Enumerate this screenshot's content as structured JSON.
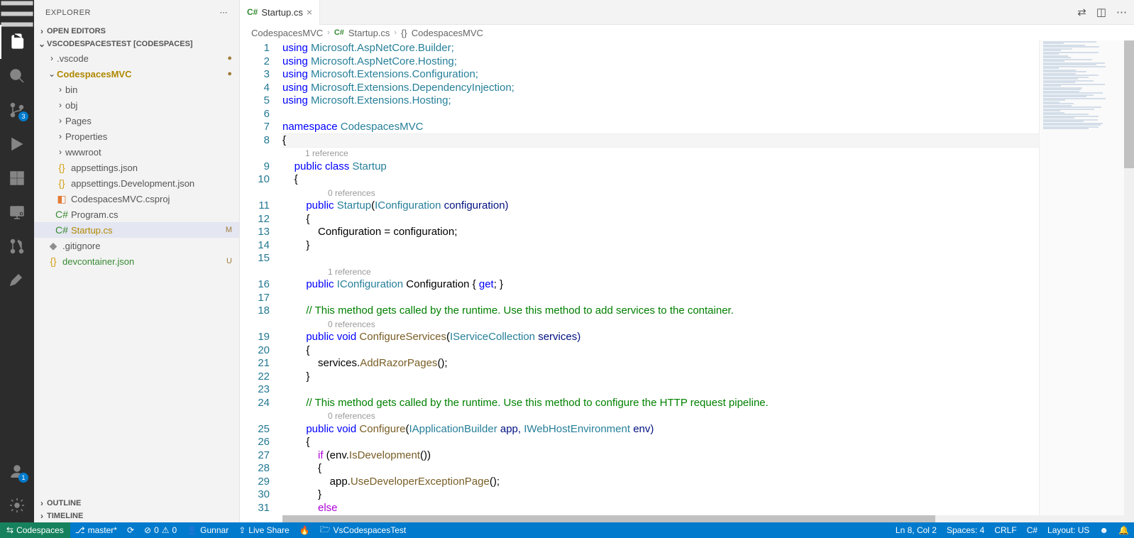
{
  "sidebar": {
    "title": "EXPLORER",
    "openEditors": "OPEN EDITORS",
    "workspace": "VSCODESPACESTEST [CODESPACES]",
    "outline": "OUTLINE",
    "timeline": "TIMELINE",
    "tree": {
      "vscode": ".vscode",
      "project": "CodespacesMVC",
      "bin": "bin",
      "obj": "obj",
      "pages": "Pages",
      "properties": "Properties",
      "wwwroot": "wwwroot",
      "appsettings": "appsettings.json",
      "appsettingsdev": "appsettings.Development.json",
      "csproj": "CodespacesMVC.csproj",
      "program": "Program.cs",
      "startup": "Startup.cs",
      "startup_badge": "M",
      "gitignore": ".gitignore",
      "devcontainer": "devcontainer.json",
      "devcontainer_badge": "U"
    }
  },
  "activity": {
    "scm_badge": "3",
    "account_badge": "1"
  },
  "tabs": {
    "startup": "Startup.cs"
  },
  "breadcrumbs": {
    "p1": "CodespacesMVC",
    "p2": "Startup.cs",
    "p3": "CodespacesMVC"
  },
  "codelens": {
    "ref1": "1 reference",
    "ref0": "0 references"
  },
  "code": {
    "l1": {
      "a": "using",
      "b": " Microsoft.AspNetCore.Builder;"
    },
    "l2": {
      "a": "using",
      "b": " Microsoft.AspNetCore.Hosting;"
    },
    "l3": {
      "a": "using",
      "b": " Microsoft.Extensions.Configuration;"
    },
    "l4": {
      "a": "using",
      "b": " Microsoft.Extensions.DependencyInjection;"
    },
    "l5": {
      "a": "using",
      "b": " Microsoft.Extensions.Hosting;"
    },
    "l7": {
      "a": "namespace",
      "b": " CodespacesMVC"
    },
    "l8": "{",
    "l9": {
      "a": "    public",
      "b": " class",
      "c": " Startup"
    },
    "l10": "    {",
    "l11": {
      "a": "        public",
      "b": " Startup",
      "c": "(",
      "d": "IConfiguration",
      "e": " configuration)"
    },
    "l12": "        {",
    "l13": {
      "a": "            Configuration = configuration;"
    },
    "l14": "        }",
    "l16": {
      "a": "        public",
      "b": " IConfiguration",
      "c": " Configuration { ",
      "d": "get",
      "e": "; }"
    },
    "l18": "        // This method gets called by the runtime. Use this method to add services to the container.",
    "l19": {
      "a": "        public",
      "b": " void",
      "c": " ConfigureServices",
      "d": "(",
      "e": "IServiceCollection",
      "f": " services)"
    },
    "l20": "        {",
    "l21": {
      "a": "            services.",
      "b": "AddRazorPages",
      "c": "();"
    },
    "l22": "        }",
    "l24": "        // This method gets called by the runtime. Use this method to configure the HTTP request pipeline.",
    "l25": {
      "a": "        public",
      "b": " void",
      "c": " Configure",
      "d": "(",
      "e": "IApplicationBuilder",
      "f": " app, ",
      "g": "IWebHostEnvironment",
      "h": " env)"
    },
    "l26": "        {",
    "l27": {
      "a": "            if",
      "b": " (env.",
      "c": "IsDevelopment",
      "d": "())"
    },
    "l28": "            {",
    "l29": {
      "a": "                app.",
      "b": "UseDeveloperExceptionPage",
      "c": "();"
    },
    "l30": "            }",
    "l31": {
      "a": "            else"
    }
  },
  "lineNumbers": [
    "1",
    "2",
    "3",
    "4",
    "5",
    "6",
    "7",
    "8",
    "",
    "9",
    "10",
    "",
    "11",
    "12",
    "13",
    "14",
    "15",
    "",
    "16",
    "17",
    "18",
    "",
    "19",
    "20",
    "21",
    "22",
    "23",
    "24",
    "",
    "25",
    "26",
    "27",
    "28",
    "29",
    "30",
    "31"
  ],
  "status": {
    "remote": "Codespaces",
    "branch": "master*",
    "errors": "0",
    "warnings": "0",
    "user": "Gunnar",
    "liveshare": "Live Share",
    "folder": "VsCodespacesTest",
    "cursor": "Ln 8, Col 2",
    "spaces": "Spaces: 4",
    "eol": "CRLF",
    "lang": "C#",
    "layout": "Layout: US"
  }
}
